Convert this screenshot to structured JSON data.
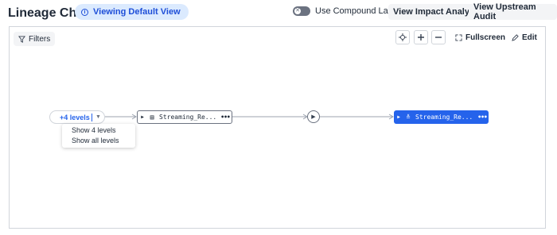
{
  "header": {
    "title": "Lineage Chart",
    "view_pill": "Viewing Default View",
    "compound_label": "Use Compound Layout",
    "impact_btn": "View Impact Analysis",
    "upstream_btn": "View Upstream Audit"
  },
  "toolbar": {
    "filters": "Filters",
    "fullscreen": "Fullscreen",
    "edit": "Edit"
  },
  "graph": {
    "levels_label": "+4 levels",
    "dropdown": [
      "Show 4 levels",
      "Show all levels"
    ],
    "node1": "Streaming_Re...",
    "node2": "Streaming_Re..."
  },
  "colors": {
    "accent": "#2563eb",
    "pill_bg": "#dbeafe"
  }
}
